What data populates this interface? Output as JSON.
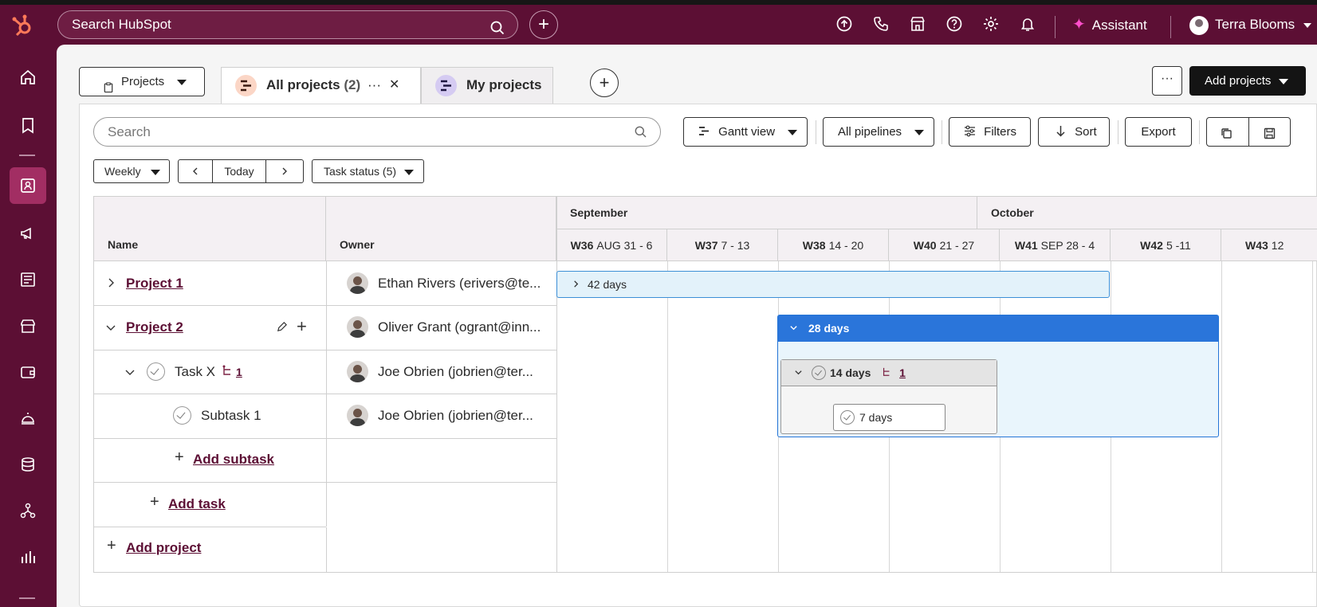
{
  "topnav": {
    "search_placeholder": "Search HubSpot",
    "assistant_label": "Assistant",
    "user_name": "Terra Blooms"
  },
  "header": {
    "object_selector": "Projects",
    "tabs": [
      {
        "label": "All projects",
        "count": "(2)"
      },
      {
        "label": "My projects"
      }
    ],
    "more_label": "···",
    "add_projects_label": "Add projects"
  },
  "toolbar": {
    "search_placeholder": "Search",
    "view_label": "Gantt view",
    "pipelines_label": "All pipelines",
    "filters_label": "Filters",
    "sort_label": "Sort",
    "export_label": "Export"
  },
  "subtoolbar": {
    "period_label": "Weekly",
    "today_label": "Today",
    "task_status_label": "Task status (5)"
  },
  "grid": {
    "name_header": "Name",
    "owner_header": "Owner",
    "months": [
      "September",
      "October"
    ],
    "weeks": [
      {
        "code": "W36",
        "range": "AUG 31 - 6"
      },
      {
        "code": "W37",
        "range": "7 - 13"
      },
      {
        "code": "W38",
        "range": "14 - 20"
      },
      {
        "code": "W40",
        "range": "21 - 27"
      },
      {
        "code": "W41",
        "range": "SEP 28 - 4"
      },
      {
        "code": "W42",
        "range": "5 -11"
      },
      {
        "code": "W43",
        "range": "12"
      }
    ],
    "rows": [
      {
        "name": "Project 1",
        "owner": "Ethan Rivers (erivers@te..."
      },
      {
        "name": "Project 2",
        "owner": "Oliver Grant (ogrant@inn..."
      },
      {
        "name": "Task X",
        "subtask_count": "1",
        "owner": "Joe Obrien (jobrien@ter..."
      },
      {
        "name": "Subtask 1",
        "owner": "Joe Obrien (jobrien@ter..."
      }
    ],
    "add_subtask_label": "Add subtask",
    "add_task_label": "Add task",
    "add_project_label": "Add project"
  },
  "bars": {
    "project1_duration": "42 days",
    "project2_duration": "28 days",
    "taskx_duration": "14 days",
    "taskx_subtask_count": "1",
    "subtask1_duration": "7 days"
  },
  "colors": {
    "nav_bg": "#5c0f34",
    "accent_link": "#5c0f34",
    "project2_bar": "#2a75da",
    "project1_bar_bg": "#e3f2fa",
    "hubspot_orange": "#ff7a59"
  }
}
